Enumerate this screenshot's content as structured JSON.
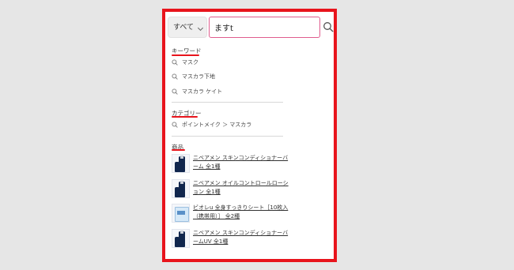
{
  "search": {
    "category": "すべて",
    "query": "ますt"
  },
  "sections": {
    "keyword": {
      "heading": "キーワード",
      "items": [
        "マスク",
        "マスカラ下地",
        "マスカラ ケイト"
      ]
    },
    "category": {
      "heading": "カテゴリー",
      "path": "ポイントメイク ＞ マスカラ"
    },
    "products": {
      "heading": "商品",
      "items": [
        {
          "title": "ニベアメン スキンコンディショナーバーム 全1種",
          "icon": "dark-bottle-pair"
        },
        {
          "title": "ニベアメン オイルコントロールローション 全1種",
          "icon": "dark-bottle-pair"
        },
        {
          "title": "ビオレu 全身すっきりシート［10枚入（携帯用）］ 全2種",
          "icon": "wipes-pack"
        },
        {
          "title": "ニベアメン スキンコンディショナーバームUV 全1種",
          "icon": "dark-bottle-pair"
        }
      ]
    }
  },
  "colors": {
    "highlight_border": "#e8141c",
    "input_border": "#e05d8e",
    "underline": "#e8141c"
  }
}
